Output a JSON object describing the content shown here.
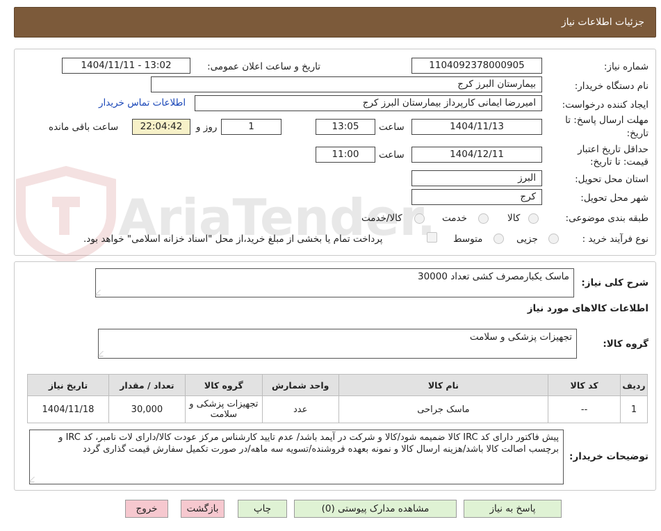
{
  "header": {
    "title": "جزئیات اطلاعات نیاز"
  },
  "watermark": {
    "text": "AriaTender.neT"
  },
  "info": {
    "need_number_label": "شماره نیاز:",
    "need_number": "1104092378000905",
    "announce_label": "تاریخ و ساعت اعلان عمومی:",
    "announce_value": "1404/11/11 - 13:02",
    "buyer_org_label": "نام دستگاه خریدار:",
    "buyer_org": "بیمارستان البرز کرج",
    "creator_label": "ایجاد کننده درخواست:",
    "creator": "امیررضا ایمانی کارپرداز بیمارستان البرز کرج",
    "contact_link": "اطلاعات تماس خریدار",
    "deadline_label_1": "مهلت ارسال پاسخ: تا",
    "deadline_label_2": "تاریخ:",
    "deadline_date": "1404/11/13",
    "time_label": "ساعت",
    "deadline_time": "13:05",
    "days_value": "1",
    "days_label": "روز و",
    "remaining_time": "22:04:42",
    "remaining_label": "ساعت باقی مانده",
    "validity_label_1": "حداقل تاریخ اعتبار",
    "validity_label_2": "قیمت: تا تاریخ:",
    "validity_date": "1404/12/11",
    "validity_time_label": "ساعت",
    "validity_time": "11:00",
    "province_label": "استان محل تحویل:",
    "province": "البرز",
    "city_label": "شهر محل تحویل:",
    "city": "کرج",
    "category_label": "طبقه بندی موضوعی:",
    "category_options": [
      "کالا",
      "خدمت",
      "کالا/خدمت"
    ],
    "purchase_type_label": "نوع فرآیند خرید :",
    "purchase_options": [
      "جزیی",
      "متوسط"
    ],
    "treasury_note": "پرداخت تمام یا بخشی از مبلغ خرید،از محل \"اسناد خزانه اسلامی\" خواهد بود."
  },
  "summary": {
    "label": "شرح کلی نیاز:",
    "value": "ماسک یکبارمصرف کشی تعداد 30000"
  },
  "goods_section": {
    "title": "اطلاعات کالاهای مورد نیاز",
    "group_label": "گروه کالا:",
    "group_value": "تجهیزات پزشکی و سلامت"
  },
  "table": {
    "headers": [
      "ردیف",
      "کد کالا",
      "نام کالا",
      "واحد شمارش",
      "گروه کالا",
      "تعداد / مقدار",
      "تاریخ نیاز"
    ],
    "rows": [
      [
        "1",
        "--",
        "ماسک جراحی",
        "عدد",
        "تجهیزات پزشکی و سلامت",
        "30,000",
        "1404/11/18"
      ]
    ]
  },
  "buyer_notes": {
    "label": "توضیحات خریدار:",
    "value": "پیش فاکتور دارای کد IRC کالا ضمیمه شود/کالا و شرکت در آیمد باشد/ عدم تایید کارشناس مرکز عودت کالا/دارای لات نامبر، کد IRC و برچسب اصالت کالا باشد/هزینه ارسال کالا و نمونه بعهده فروشنده/تسویه سه ماهه/در صورت تکمیل سفارش قیمت گذاری گردد"
  },
  "buttons": {
    "reply": "پاسخ به نیاز",
    "attachments": "مشاهده مدارک پیوستی (0)",
    "print": "چاپ",
    "back": "بازگشت",
    "exit": "خروج"
  },
  "colors": {
    "header_bg": "#7c5a3a",
    "link": "#1a47b8",
    "remaining_bg": "#f7f1c8",
    "button_green": "#dff2d4",
    "button_pink": "#f6c8cf"
  }
}
